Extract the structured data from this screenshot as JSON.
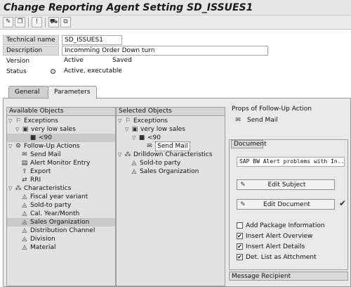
{
  "window": {
    "title": "Change Reporting Agent Setting SD_ISSUES1"
  },
  "toolbar": {
    "buttons": [
      {
        "icon": "display-change-icon",
        "glyph": "✎"
      },
      {
        "icon": "copy-icon",
        "glyph": "❐"
      },
      {
        "icon": "activate-icon",
        "glyph": "!"
      },
      {
        "icon": "transport-icon",
        "glyph": "⛟"
      },
      {
        "icon": "where-used-icon",
        "glyph": "⧉"
      }
    ]
  },
  "header": {
    "technical_name": {
      "label": "Technical name",
      "value": "SD_ISSUES1"
    },
    "description": {
      "label": "Description",
      "value": "Incomming Order Down turn"
    },
    "version": {
      "label": "Version",
      "value": "Active",
      "extra": "Saved"
    },
    "status": {
      "label": "Status",
      "value": "Active, executable"
    }
  },
  "tabs": [
    {
      "label": "General",
      "active": false
    },
    {
      "label": "Parameters",
      "active": true
    }
  ],
  "available_objects": {
    "title": "Available Objects",
    "items": [
      {
        "label": "Exceptions",
        "icon": "exceptions-icon",
        "glyph": "⚐",
        "toggle": "▽"
      },
      {
        "label": "very low sales",
        "icon": "exception-icon",
        "glyph": "▣",
        "toggle": "▽"
      },
      {
        "label": "<90",
        "icon": "threshold-icon",
        "glyph": "■",
        "toggle": ""
      },
      {
        "label": "Follow-Up Actions",
        "icon": "followup-actions-icon",
        "glyph": "⚙",
        "toggle": "▽"
      },
      {
        "label": "Send Mail",
        "icon": "send-mail-icon",
        "glyph": "✉",
        "toggle": ""
      },
      {
        "label": "Alert Monitor Entry",
        "icon": "alert-monitor-icon",
        "glyph": "▤",
        "toggle": ""
      },
      {
        "label": "Export",
        "icon": "export-icon",
        "glyph": "⇪",
        "toggle": ""
      },
      {
        "label": "RRI",
        "icon": "rri-icon",
        "glyph": "⇄",
        "toggle": ""
      },
      {
        "label": "Characteristics",
        "icon": "characteristics-icon",
        "glyph": "⁂",
        "toggle": "▽"
      },
      {
        "label": "Fiscal year variant",
        "icon": "characteristic-icon",
        "glyph": "◬",
        "toggle": ""
      },
      {
        "label": "Sold-to party",
        "icon": "characteristic-icon",
        "glyph": "◬",
        "toggle": ""
      },
      {
        "label": "Cal. Year/Month",
        "icon": "characteristic-icon",
        "glyph": "◬",
        "toggle": ""
      },
      {
        "label": "Sales Organization",
        "icon": "characteristic-icon",
        "glyph": "◬",
        "toggle": ""
      },
      {
        "label": "Distribution Channel",
        "icon": "characteristic-icon",
        "glyph": "◬",
        "toggle": ""
      },
      {
        "label": "Division",
        "icon": "characteristic-icon",
        "glyph": "◬",
        "toggle": ""
      },
      {
        "label": "Material",
        "icon": "characteristic-icon",
        "glyph": "◬",
        "toggle": ""
      }
    ]
  },
  "selected_objects": {
    "title": "Selected Objects",
    "items": [
      {
        "label": "Exceptions",
        "icon": "exceptions-icon",
        "glyph": "⚐",
        "toggle": "▽"
      },
      {
        "label": "very low sales",
        "icon": "exception-icon",
        "glyph": "▣",
        "toggle": "▽"
      },
      {
        "label": "<90",
        "icon": "threshold-icon",
        "glyph": "■",
        "toggle": "▽"
      },
      {
        "label": "Send Mail",
        "icon": "send-mail-icon",
        "glyph": "✉",
        "toggle": ""
      },
      {
        "label": "Drilldown Characteristics",
        "icon": "drilldown-icon",
        "glyph": "⁂",
        "toggle": "▽"
      },
      {
        "label": "Sold-to party",
        "icon": "characteristic-icon",
        "glyph": "◬",
        "toggle": ""
      },
      {
        "label": "Sales Organization",
        "icon": "characteristic-icon",
        "glyph": "◬",
        "toggle": ""
      }
    ]
  },
  "props": {
    "title": "Props of Follow-Up Action",
    "action": "Send Mail",
    "document_tab": "Document",
    "subject": "SAP BW Alert  problems with In...",
    "edit_subject": "Edit Subject",
    "edit_document": "Edit Document",
    "checkboxes": [
      {
        "label": "Add Package Information",
        "checked": ""
      },
      {
        "label": "Insert Alert Overview",
        "checked": "✔"
      },
      {
        "label": "Insert Alert Details",
        "checked": "✔"
      },
      {
        "label": "Det. List as Attchment",
        "checked": "✔"
      }
    ],
    "message_recipient_tab": "Message Recipient"
  }
}
